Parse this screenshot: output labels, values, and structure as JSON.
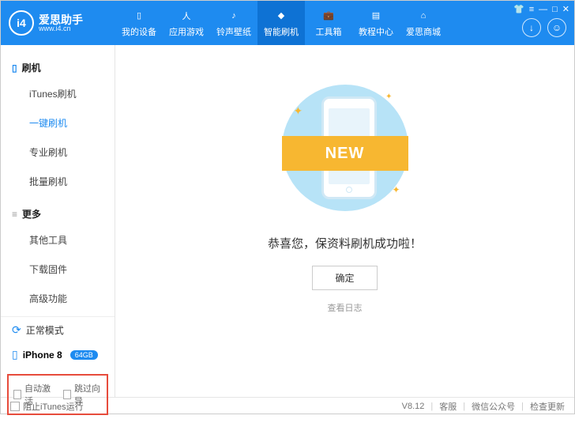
{
  "brand": {
    "title": "爱思助手",
    "sub": "www.i4.cn",
    "logo_text": "i4"
  },
  "nav": {
    "items": [
      {
        "label": "我的设备",
        "icon": "phone"
      },
      {
        "label": "应用游戏",
        "icon": "apps"
      },
      {
        "label": "铃声壁纸",
        "icon": "music"
      },
      {
        "label": "智能刷机",
        "icon": "flash"
      },
      {
        "label": "工具箱",
        "icon": "tools"
      },
      {
        "label": "教程中心",
        "icon": "book"
      },
      {
        "label": "爱思商城",
        "icon": "shop"
      }
    ],
    "active_index": 3
  },
  "sidebar": {
    "sections": [
      {
        "header": "刷机",
        "items": [
          "iTunes刷机",
          "一键刷机",
          "专业刷机",
          "批量刷机"
        ],
        "active_index": 1
      },
      {
        "header": "更多",
        "items": [
          "其他工具",
          "下载固件",
          "高级功能"
        ],
        "active_index": -1
      }
    ],
    "status": "正常模式",
    "device": {
      "name": "iPhone 8",
      "badge": "64GB"
    },
    "options": {
      "auto_activate": "自动激活",
      "skip_wizard": "跳过向导"
    }
  },
  "main": {
    "ribbon": "NEW",
    "message": "恭喜您，保资料刷机成功啦！",
    "confirm": "确定",
    "view_log": "查看日志"
  },
  "footer": {
    "block_itunes": "阻止iTunes运行",
    "version": "V8.12",
    "support": "客服",
    "wechat": "微信公众号",
    "check_update": "检查更新"
  }
}
